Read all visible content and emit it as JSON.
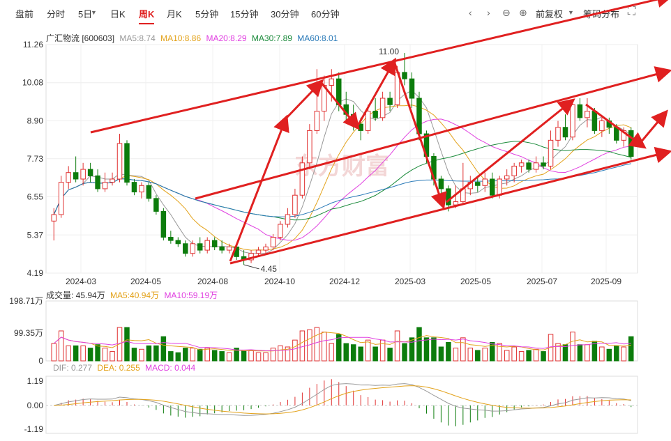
{
  "toolbar": {
    "tabs": [
      "盘前",
      "分时",
      "5日",
      "日K",
      "周K",
      "月K",
      "5分钟",
      "15分钟",
      "30分钟",
      "60分钟"
    ],
    "active_tab": "周K",
    "fuquan": "前复权",
    "chip": "筹码分布"
  },
  "colors": {
    "up": "#e03030",
    "down": "#0c7c0c",
    "ma5": "#999999",
    "ma10": "#e3a21a",
    "ma20": "#e040e0",
    "ma30": "#1a8a3a",
    "ma60": "#2a7ab8",
    "arrow": "#e02020"
  },
  "main_legend": {
    "name": "广汇物流 [600603]",
    "ma5": "MA5:8.74",
    "ma10": "MA10:8.86",
    "ma20": "MA20:8.29",
    "ma30": "MA30:7.89",
    "ma60": "MA60:8.01"
  },
  "vol_legend": {
    "vol": "成交量: 45.94万",
    "ma5": "MA5:40.94万",
    "ma10": "MA10:59.19万"
  },
  "macd_legend": {
    "dif": "DIF: 0.277",
    "dea": "DEA: 0.255",
    "macd": "MACD: 0.044"
  },
  "watermark": "东方财富",
  "chart_data": {
    "type": "candlestick",
    "price_ticks": [
      "11.26",
      "10.08",
      "8.90",
      "7.73",
      "6.55",
      "5.37",
      "4.19"
    ],
    "ylim": [
      4.19,
      11.26
    ],
    "x_labels": [
      "2024-03",
      "2024-05",
      "2024-08",
      "2024-10",
      "2024-12",
      "2025-03",
      "2025-05",
      "2025-07",
      "2025-09"
    ],
    "annotations": {
      "high": "11.00",
      "low": "4.45"
    },
    "candles": [
      [
        5.8,
        6.2,
        5.2,
        6.0
      ],
      [
        6.0,
        7.2,
        5.9,
        7.0
      ],
      [
        7.0,
        7.5,
        6.8,
        7.3
      ],
      [
        7.3,
        7.8,
        7.0,
        7.1
      ],
      [
        7.1,
        7.6,
        6.9,
        7.4
      ],
      [
        7.4,
        7.6,
        7.0,
        7.2
      ],
      [
        7.2,
        7.4,
        6.7,
        6.8
      ],
      [
        6.8,
        7.3,
        6.7,
        7.0
      ],
      [
        7.0,
        7.3,
        6.9,
        7.1
      ],
      [
        7.1,
        8.5,
        7.0,
        8.2
      ],
      [
        8.2,
        8.3,
        6.9,
        7.0
      ],
      [
        7.0,
        7.1,
        6.6,
        6.7
      ],
      [
        6.7,
        7.0,
        6.5,
        6.9
      ],
      [
        6.9,
        7.0,
        6.4,
        6.5
      ],
      [
        6.5,
        6.6,
        6.0,
        6.1
      ],
      [
        6.1,
        6.2,
        5.2,
        5.3
      ],
      [
        5.3,
        5.5,
        5.1,
        5.2
      ],
      [
        5.2,
        5.3,
        5.0,
        5.1
      ],
      [
        5.1,
        5.2,
        4.7,
        4.8
      ],
      [
        4.8,
        5.2,
        4.7,
        5.1
      ],
      [
        5.1,
        5.3,
        4.8,
        4.9
      ],
      [
        4.9,
        5.3,
        4.8,
        5.2
      ],
      [
        5.2,
        5.3,
        4.9,
        5.0
      ],
      [
        5.0,
        5.2,
        4.8,
        4.9
      ],
      [
        4.9,
        5.1,
        4.8,
        5.0
      ],
      [
        5.0,
        5.1,
        4.6,
        4.7
      ],
      [
        4.7,
        4.9,
        4.45,
        4.6
      ],
      [
        4.6,
        4.9,
        4.5,
        4.8
      ],
      [
        4.8,
        5.0,
        4.7,
        4.9
      ],
      [
        4.9,
        5.1,
        4.8,
        5.0
      ],
      [
        5.0,
        5.4,
        4.9,
        5.3
      ],
      [
        5.3,
        5.8,
        5.2,
        5.7
      ],
      [
        5.7,
        6.2,
        5.6,
        6.0
      ],
      [
        6.0,
        6.8,
        5.9,
        6.6
      ],
      [
        6.6,
        7.8,
        6.5,
        7.6
      ],
      [
        7.6,
        8.8,
        7.4,
        8.6
      ],
      [
        8.6,
        10.5,
        8.5,
        9.2
      ],
      [
        9.2,
        10.3,
        8.9,
        10.0
      ],
      [
        10.0,
        10.5,
        9.5,
        10.2
      ],
      [
        10.2,
        10.4,
        9.2,
        9.4
      ],
      [
        9.4,
        9.8,
        8.9,
        9.1
      ],
      [
        9.1,
        9.4,
        8.6,
        8.8
      ],
      [
        8.8,
        9.0,
        8.3,
        8.6
      ],
      [
        8.6,
        9.4,
        8.5,
        9.2
      ],
      [
        9.2,
        9.6,
        8.9,
        9.0
      ],
      [
        9.0,
        9.8,
        8.9,
        9.6
      ],
      [
        9.6,
        9.8,
        9.2,
        9.4
      ],
      [
        9.4,
        10.6,
        9.3,
        10.4
      ],
      [
        10.4,
        11.0,
        10.0,
        10.2
      ],
      [
        10.2,
        10.4,
        9.3,
        9.6
      ],
      [
        9.6,
        9.8,
        8.3,
        8.5
      ],
      [
        8.5,
        8.6,
        7.6,
        7.8
      ],
      [
        7.8,
        7.9,
        6.9,
        7.1
      ],
      [
        7.1,
        7.2,
        6.6,
        6.8
      ],
      [
        6.8,
        6.9,
        6.1,
        6.3
      ],
      [
        6.3,
        6.9,
        6.2,
        6.4
      ],
      [
        6.4,
        7.6,
        6.3,
        6.8
      ],
      [
        6.8,
        7.2,
        6.6,
        7.0
      ],
      [
        7.0,
        7.2,
        6.7,
        6.9
      ],
      [
        6.9,
        7.3,
        6.7,
        7.1
      ],
      [
        7.1,
        7.3,
        6.5,
        6.6
      ],
      [
        6.6,
        7.2,
        6.5,
        7.1
      ],
      [
        7.1,
        7.4,
        6.9,
        7.2
      ],
      [
        7.2,
        7.6,
        7.0,
        7.5
      ],
      [
        7.5,
        7.7,
        7.3,
        7.6
      ],
      [
        7.6,
        7.7,
        7.3,
        7.4
      ],
      [
        7.4,
        7.8,
        7.3,
        7.6
      ],
      [
        7.6,
        7.8,
        7.4,
        7.5
      ],
      [
        7.5,
        8.6,
        7.4,
        8.3
      ],
      [
        8.3,
        8.9,
        8.1,
        8.7
      ],
      [
        8.7,
        9.1,
        8.3,
        8.4
      ],
      [
        8.4,
        9.5,
        8.3,
        9.4
      ],
      [
        9.4,
        9.6,
        8.9,
        9.0
      ],
      [
        9.0,
        9.6,
        8.7,
        9.2
      ],
      [
        9.2,
        9.3,
        8.5,
        8.6
      ],
      [
        8.6,
        9.0,
        8.4,
        8.9
      ],
      [
        8.9,
        9.0,
        8.5,
        8.7
      ],
      [
        8.7,
        8.8,
        8.2,
        8.3
      ],
      [
        8.3,
        8.7,
        8.1,
        8.6
      ],
      [
        8.6,
        8.7,
        7.7,
        7.8
      ]
    ],
    "volume": {
      "ylim": [
        0,
        198.71
      ],
      "ticks": [
        "198.71万",
        "99.35万",
        "0"
      ]
    },
    "macd": {
      "ylim": [
        -1.19,
        1.19
      ],
      "ticks": [
        "1.19",
        "0.00",
        "-1.19"
      ]
    }
  }
}
